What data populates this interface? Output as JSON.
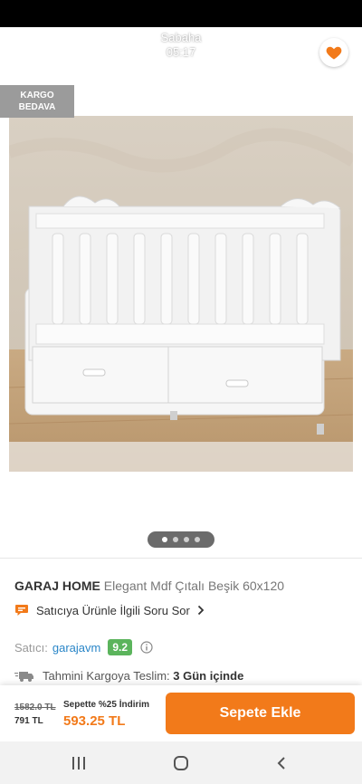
{
  "header": {
    "time_label": "Sabaha",
    "time_value": "05:17",
    "back_icon": "arrow-left-icon",
    "share_icon": "share-icon",
    "favorite_icon": "heart-icon"
  },
  "badge": {
    "line1": "KARGO",
    "line2": "BEDAVA"
  },
  "gallery": {
    "total": 4,
    "active_index": 0
  },
  "product": {
    "brand": "GARAJ HOME",
    "name": "Elegant Mdf Çıtalı Beşik 60x120"
  },
  "ask_seller": {
    "label": "Satıcıya Ürünle İlgili Soru Sor",
    "icon": "chat-bubble-icon"
  },
  "seller": {
    "label": "Satıcı:",
    "name": "garajavm",
    "rating": "9.2"
  },
  "delivery": {
    "label": "Tahmini Kargoya Teslim:",
    "value": "3 Gün içinde",
    "icon": "truck-icon"
  },
  "price": {
    "old": "1582.0 TL",
    "base": "791 TL",
    "promo": "Sepette %25 İndirim",
    "final": "593.25 TL"
  },
  "cart": {
    "button": "Sepete Ekle"
  },
  "colors": {
    "accent": "#f27a1a",
    "rating": "#5bb45c",
    "link": "#2a86c8",
    "badge": "#9b9b9b"
  }
}
